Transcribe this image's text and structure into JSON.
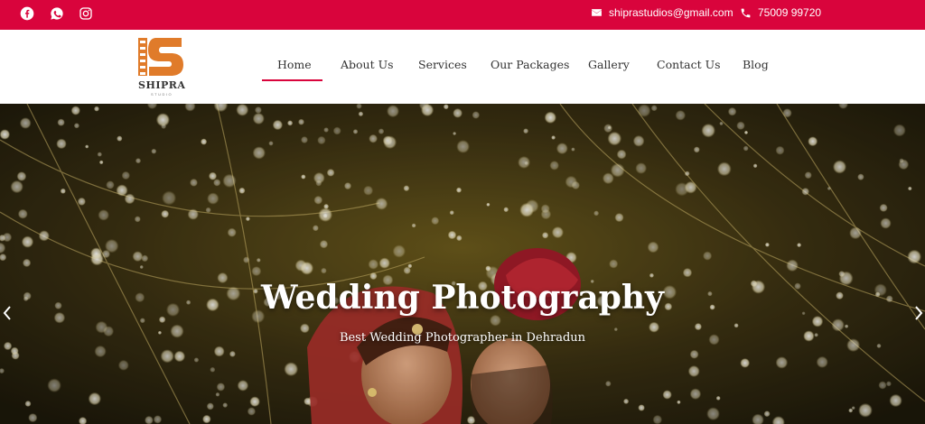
{
  "topbar": {
    "social": [
      {
        "name": "facebook-icon"
      },
      {
        "name": "whatsapp-icon"
      },
      {
        "name": "instagram-icon"
      }
    ],
    "email": "shiprastudios@gmail.com",
    "phone": "75009 99720"
  },
  "logo": {
    "text": "SHIPRA",
    "subtext": "STUDIO"
  },
  "nav": {
    "items": [
      {
        "label": "Home",
        "active": true
      },
      {
        "label": "About Us"
      },
      {
        "label": "Services"
      },
      {
        "label": "Our Packages"
      },
      {
        "label": "Gallery"
      },
      {
        "label": "Contact Us"
      },
      {
        "label": "Blog"
      }
    ]
  },
  "hero": {
    "title": "Wedding Photography",
    "subtitle": "Best Wedding Photographer in Dehradun"
  },
  "colors": {
    "accent": "#d9043c",
    "logo_orange": "#e07b2a"
  }
}
